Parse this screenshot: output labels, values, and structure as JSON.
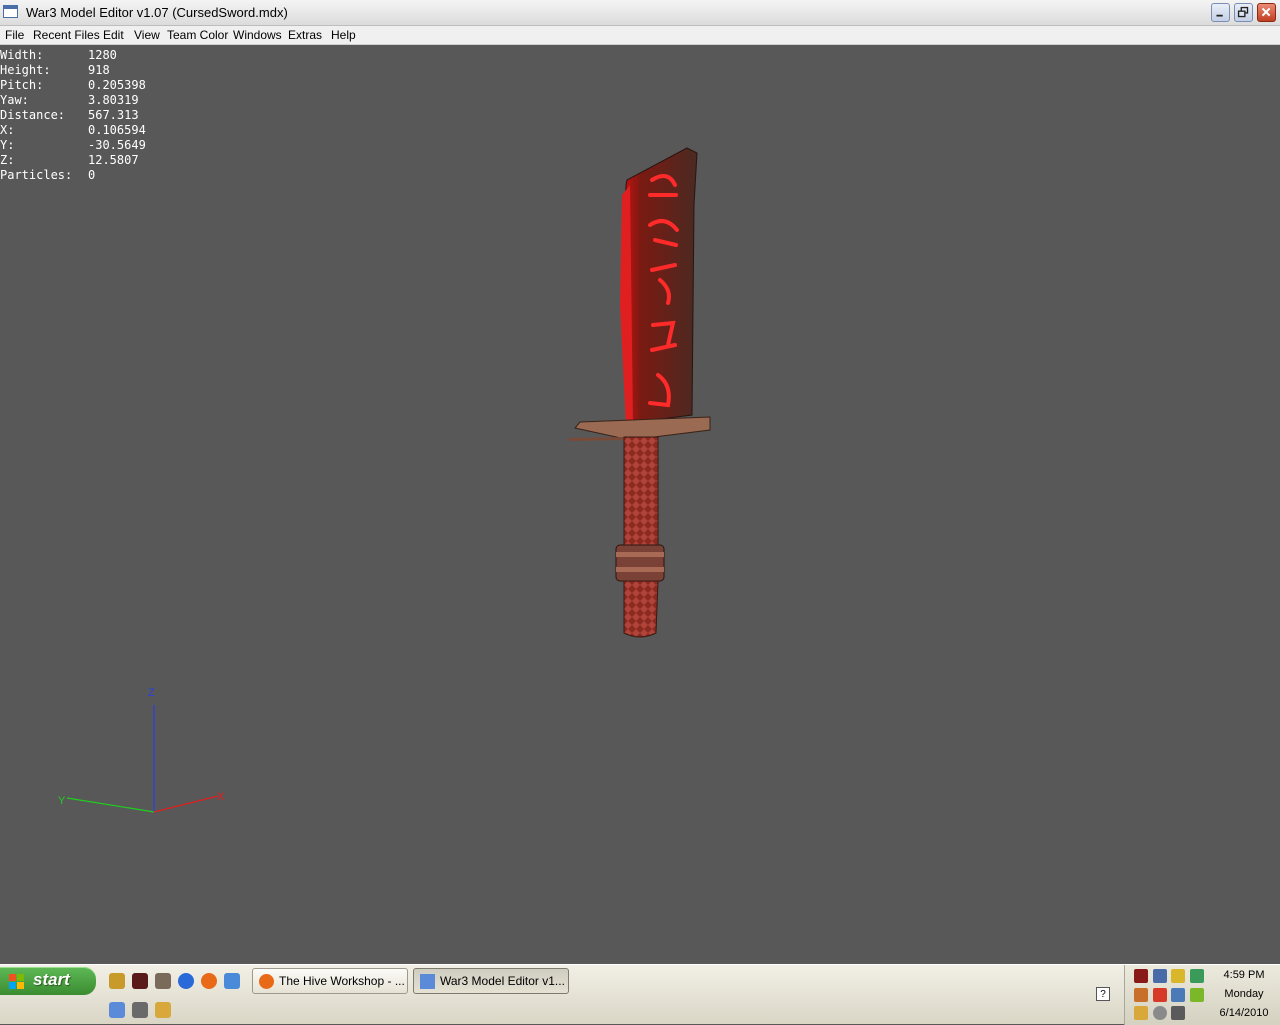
{
  "window": {
    "title": "War3 Model Editor v1.07 (CursedSword.mdx)",
    "controls": {
      "minimize": "minimize-icon",
      "maximize": "restore-icon",
      "close": "close-icon"
    }
  },
  "menu": [
    "File",
    "Recent Files",
    "Edit",
    "View",
    "Team Color",
    "Windows",
    "Extras",
    "Help"
  ],
  "stats": [
    {
      "label": "Width:",
      "value": "1280"
    },
    {
      "label": "Height:",
      "value": "918"
    },
    {
      "label": "Pitch:",
      "value": "0.205398"
    },
    {
      "label": "Yaw:",
      "value": "3.80319"
    },
    {
      "label": "Distance:",
      "value": "567.313"
    },
    {
      "label": "X:",
      "value": "0.106594"
    },
    {
      "label": "Y:",
      "value": "-30.5649"
    },
    {
      "label": "Z:",
      "value": "12.5807"
    },
    {
      "label": "Particles:",
      "value": "0"
    }
  ],
  "axes": {
    "z": {
      "label": "Z",
      "color": "#2a3fe0"
    },
    "y": {
      "label": "Y",
      "color": "#1fcf1f"
    },
    "x": {
      "label": "X",
      "color": "#e02020"
    }
  },
  "viewport": {
    "background": "#585858"
  },
  "taskbar": {
    "start_label": "start",
    "quick_launch": [
      "key-icon",
      "media-icon",
      "gimp-icon",
      "ie-icon",
      "firefox-icon",
      "web-icon",
      "window-icon",
      "camera-icon",
      "pencil-icon"
    ],
    "tasks": [
      {
        "label": "The Hive Workshop - ...",
        "icon": "firefox-icon",
        "active": false
      },
      {
        "label": "War3 Model Editor v1...",
        "icon": "window-icon",
        "active": true
      }
    ],
    "help_glyph": "?",
    "tray_icons": [
      "app-tray-icon",
      "network-tray-icon",
      "shield-tray-icon",
      "people-tray-icon",
      "volume-tray-icon",
      "windows-tray-icon",
      "network2-tray-icon",
      "nvidia-tray-icon",
      "pencil-tray-icon",
      "gear-tray-icon",
      "star-tray-icon"
    ],
    "clock": {
      "time": "4:59 PM",
      "day": "Monday",
      "date": "6/14/2010"
    }
  }
}
